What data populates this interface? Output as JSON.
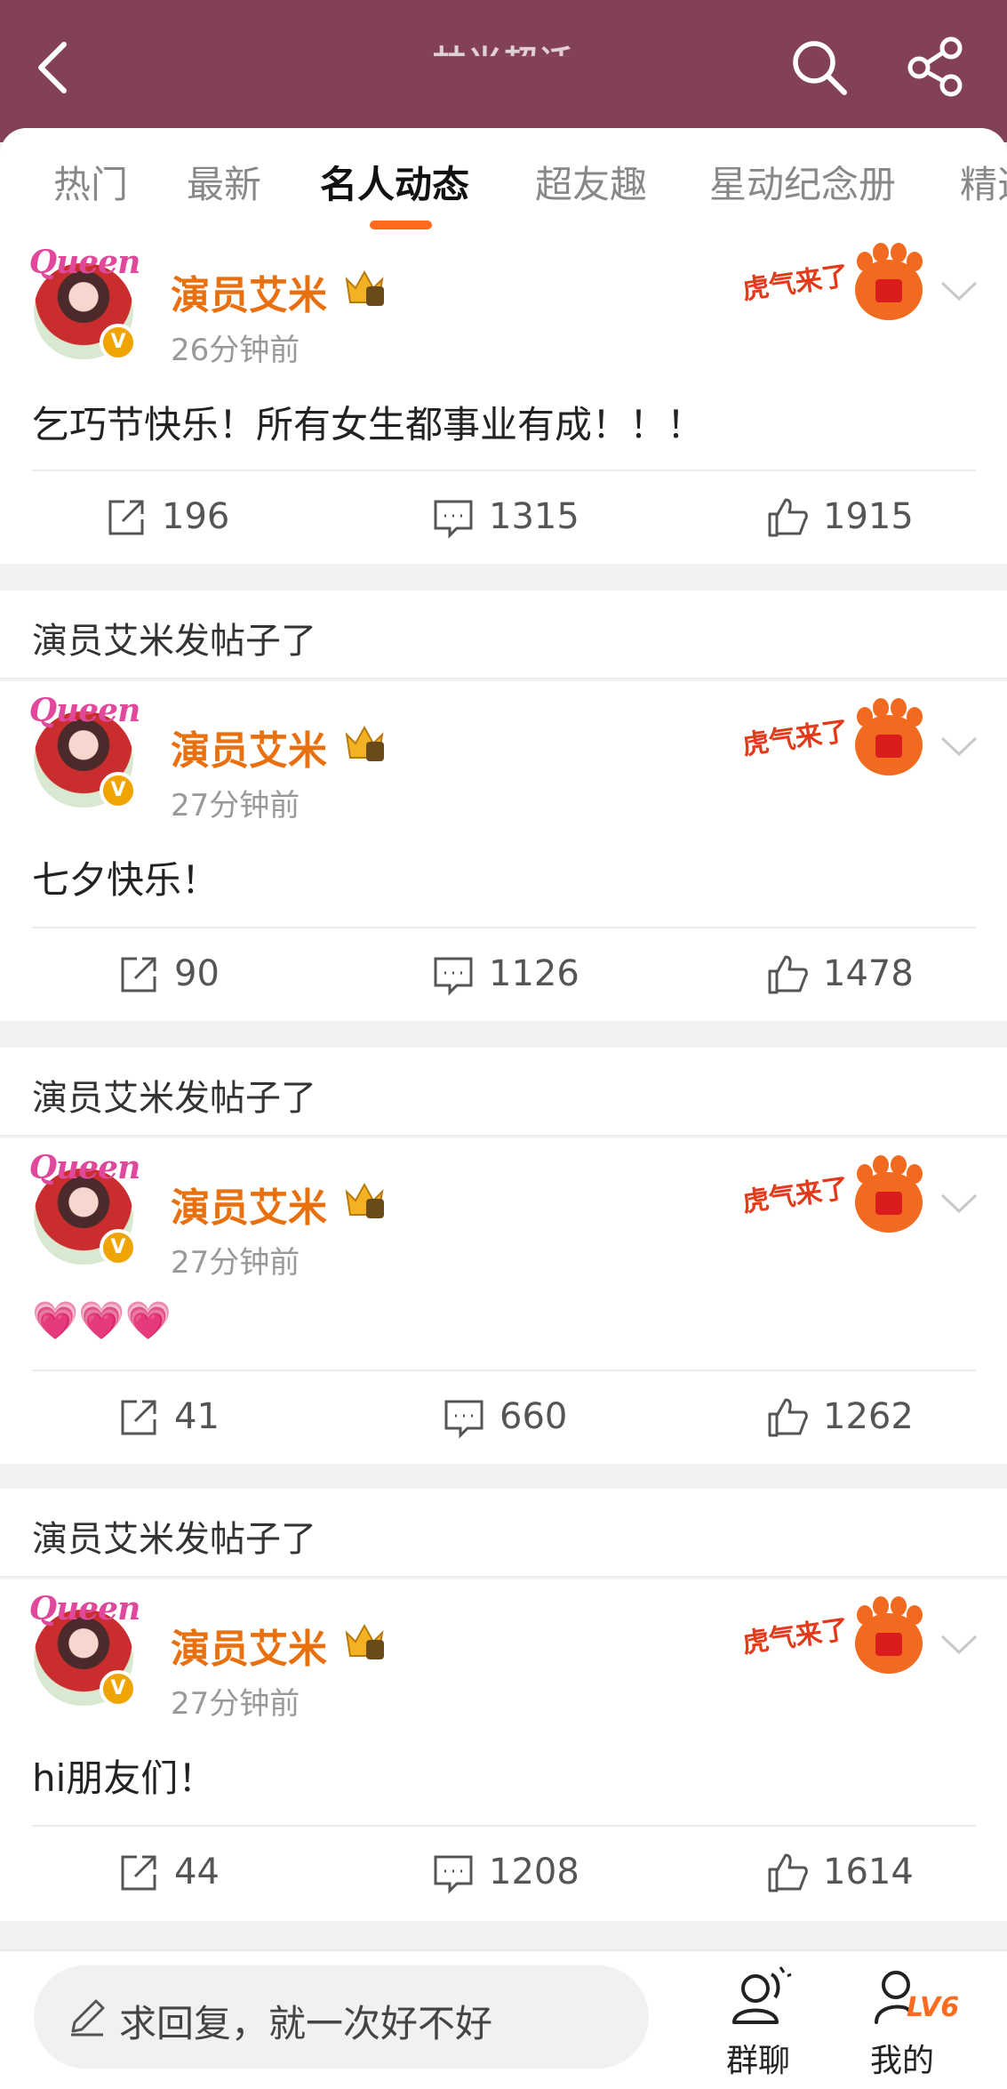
{
  "header": {
    "title": "林米超话"
  },
  "tabs": [
    {
      "label": "热门",
      "active": false
    },
    {
      "label": "最新",
      "active": false
    },
    {
      "label": "名人动态",
      "active": true
    },
    {
      "label": "超友趣",
      "active": false
    },
    {
      "label": "星动纪念册",
      "active": false
    },
    {
      "label": "精选",
      "active": false
    }
  ],
  "posts": [
    {
      "section_title": "",
      "user": "演员艾米",
      "time": "26分钟前",
      "text": "乞巧节快乐！所有女生都事业有成！！！",
      "reposts": "196",
      "comments": "1315",
      "likes": "1915"
    },
    {
      "section_title": "演员艾米发帖子了",
      "user": "演员艾米",
      "time": "27分钟前",
      "text": "七夕快乐！",
      "reposts": "90",
      "comments": "1126",
      "likes": "1478"
    },
    {
      "section_title": "演员艾米发帖子了",
      "user": "演员艾米",
      "time": "27分钟前",
      "text": "💗💗💗",
      "reposts": "41",
      "comments": "660",
      "likes": "1262"
    },
    {
      "section_title": "演员艾米发帖子了",
      "user": "演员艾米",
      "time": "27分钟前",
      "text": "hi朋友们！",
      "reposts": "44",
      "comments": "1208",
      "likes": "1614"
    }
  ],
  "avatar": {
    "label": "Queen",
    "badge": "V"
  },
  "sticker": {
    "text": "虎气来了",
    "icon": "tiger-paw-fu-icon"
  },
  "bottom_bar": {
    "reply_placeholder": "求回复，就一次好不好",
    "group_chat_label": "群聊",
    "mine_label": "我的",
    "level": "LV6"
  },
  "colors": {
    "header": "#834159",
    "accent": "#ff6a1f",
    "username": "#e8700f"
  }
}
